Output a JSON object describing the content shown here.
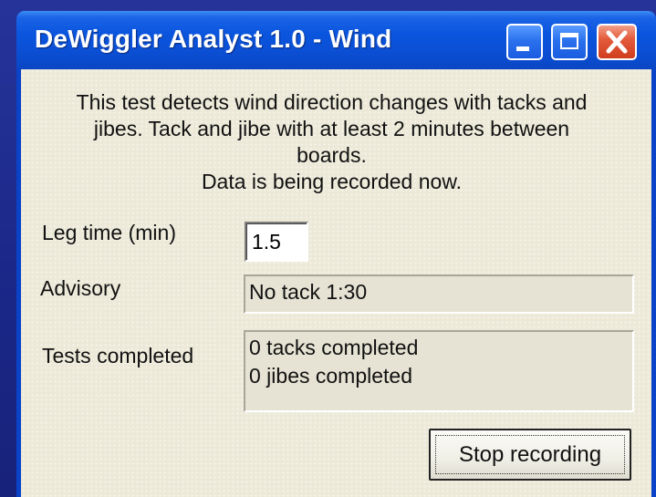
{
  "window": {
    "title": "DeWiggler Analyst 1.0 - Wind",
    "title_bar_color": "#0a55de",
    "close_color": "#e45c3c"
  },
  "icons": {
    "minimize": "minimize-icon",
    "maximize": "maximize-icon",
    "close": "close-icon"
  },
  "description": {
    "line1": "This test detects wind direction changes with tacks and",
    "line2": "jibes. Tack and jibe with at least 2 minutes between",
    "line3": "boards.",
    "line4": "Data is being recorded now."
  },
  "leg_time": {
    "label": "Leg time (min)",
    "value": "1.5"
  },
  "advisory": {
    "label": "Advisory",
    "value": "No tack 1:30"
  },
  "tests": {
    "label": "Tests completed",
    "line1": "0 tacks completed",
    "line2": "0 jibes completed"
  },
  "buttons": {
    "stop_label": "Stop recording"
  }
}
